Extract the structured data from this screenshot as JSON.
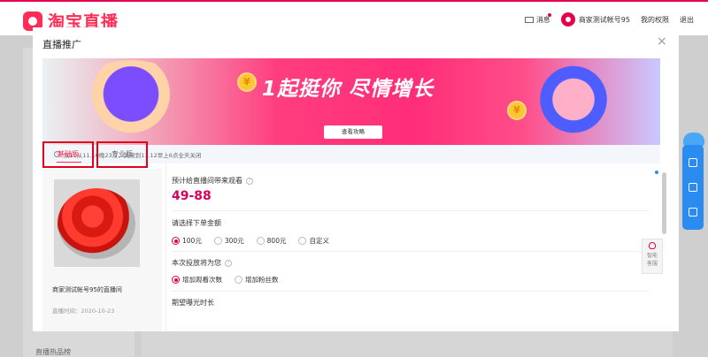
{
  "header": {
    "logo_text": "淘宝直播",
    "messages_label": "消息",
    "account_name": "商家测试帐号95",
    "permissions_label": "我的权限",
    "logout_label": "退出"
  },
  "background": {
    "sidebar_items": [
      "直播热品榜"
    ]
  },
  "modal": {
    "title": "直播推广",
    "close_symbol": "×",
    "banner": {
      "slogan": "1起挺你 尽情增长",
      "button_label": "查看攻略",
      "coin_symbol": "¥"
    },
    "notice": "双11从11.10晚23点，关闭到11.12早上6点全天关闭",
    "tabs": [
      {
        "label": "基础版",
        "active": true
      },
      {
        "label": "专业版",
        "active": false
      }
    ],
    "room": {
      "name": "商家测试帐号95的直播间",
      "time_label": "直播时间：",
      "time_value": "2020-10-23"
    },
    "form": {
      "estimate_label": "预计给直播间带来观看",
      "estimate_value": "49-88",
      "amount_label": "请选择下单金额",
      "amount_options": [
        {
          "label": "100元",
          "selected": true
        },
        {
          "label": "300元",
          "selected": false
        },
        {
          "label": "800元",
          "selected": false
        },
        {
          "label": "自定义",
          "selected": false
        }
      ],
      "goal_label": "本次投放将为您",
      "goal_options": [
        {
          "label": "增加观看次数",
          "selected": true
        },
        {
          "label": "增加粉丝数",
          "selected": false
        }
      ],
      "duration_label": "期望曝光时长"
    },
    "customer_service": {
      "line1": "智能",
      "line2": "客服"
    }
  },
  "colors": {
    "brand": "#e5004f",
    "accent_blue": "#2a8cf0",
    "estimate_text": "#d8005c"
  }
}
